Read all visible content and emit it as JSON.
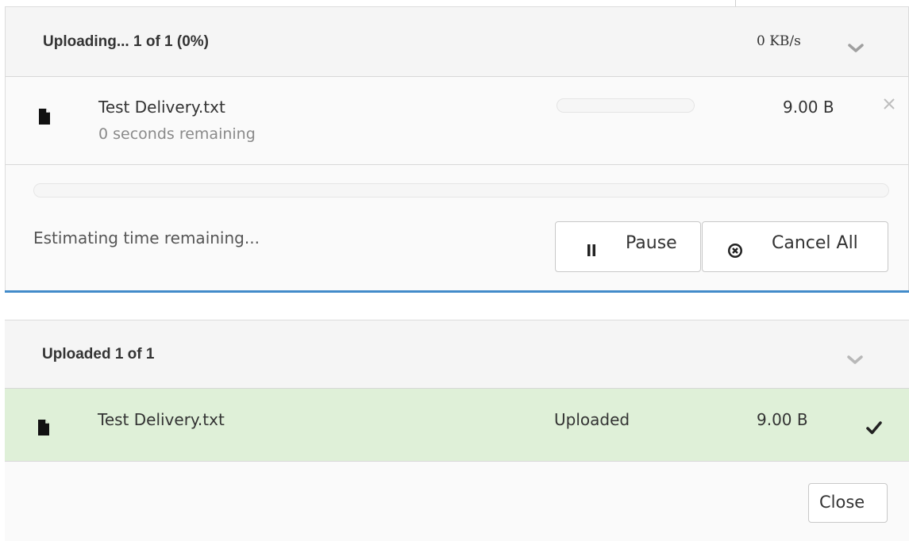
{
  "upload_panel": {
    "title": "Uploading... 1 of 1 (0%)",
    "speed": "0 KB/s",
    "file": {
      "name": "Test Delivery.txt",
      "time_remaining": "0 seconds remaining",
      "size": "9.00 B",
      "progress_fraction": 0
    },
    "overall_progress_fraction": 0,
    "status": "Estimating time remaining...",
    "pause_label": "Pause",
    "cancel_all_label": "Cancel All"
  },
  "uploaded_panel": {
    "title": "Uploaded 1 of 1",
    "file": {
      "name": "Test Delivery.txt",
      "status": "Uploaded",
      "size": "9.00 B"
    },
    "close_label": "Close"
  },
  "colors": {
    "accent": "#428bca",
    "success_row": "#dff0d8",
    "header_bg": "#f5f5f5"
  },
  "icons": [
    "chevron-down-icon",
    "file-icon",
    "close-icon",
    "pause-icon",
    "cancel-circle-icon",
    "check-icon"
  ]
}
